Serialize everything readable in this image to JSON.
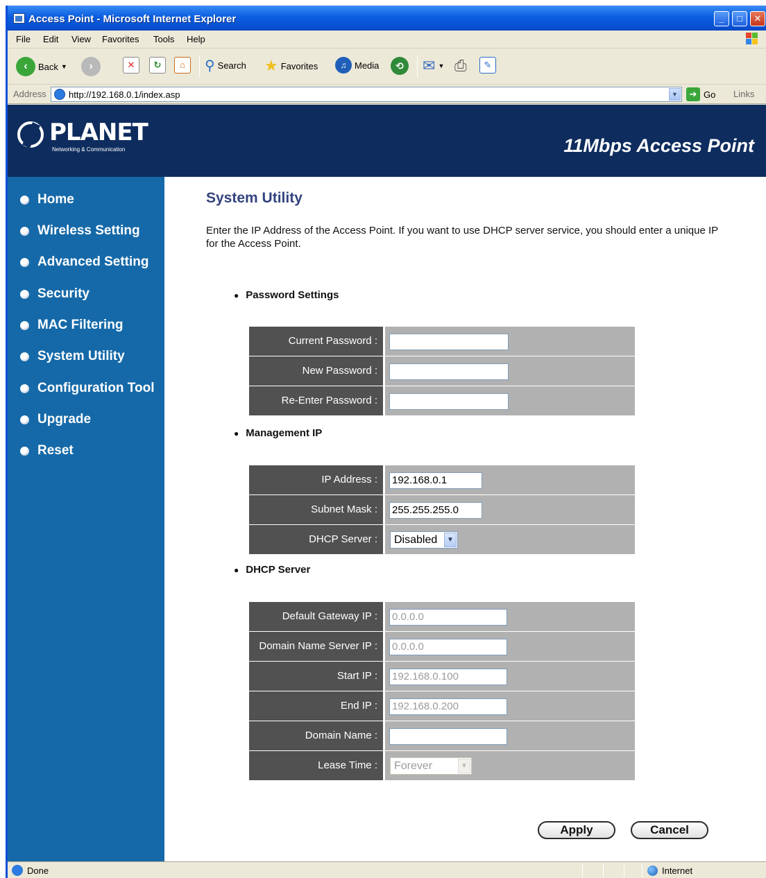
{
  "window": {
    "title": "Access Point - Microsoft Internet Explorer",
    "controls": {
      "minimize": "_",
      "maximize": "□",
      "close": "✕"
    }
  },
  "menu": [
    "File",
    "Edit",
    "View",
    "Favorites",
    "Tools",
    "Help"
  ],
  "toolbar": {
    "back_label": "Back",
    "search_label": "Search",
    "favorites_label": "Favorites",
    "media_label": "Media"
  },
  "address": {
    "label": "Address",
    "url": "http://192.168.0.1/index.asp",
    "go_label": "Go",
    "links_label": "Links"
  },
  "header": {
    "logo_text": "PLANET",
    "logo_sub": "Networking & Communication",
    "product": "11Mbps Access Point"
  },
  "sidebar": {
    "items": [
      "Home",
      "Wireless Setting",
      "Advanced Setting",
      "Security",
      "MAC Filtering",
      "System Utility",
      "Configuration Tool",
      "Upgrade",
      "Reset"
    ]
  },
  "main": {
    "title": "System Utility",
    "description": "Enter the IP Address of the Access Point. If you want to use DHCP server service, you should enter a unique IP for the Access Point.",
    "password_section": "Password Settings",
    "password_rows": [
      {
        "label": "Current Password :",
        "value": ""
      },
      {
        "label": "New Password :",
        "value": ""
      },
      {
        "label": "Re-Enter Password :",
        "value": ""
      }
    ],
    "management_section": "Management IP",
    "management_rows": [
      {
        "label": "IP Address :",
        "value": "192.168.0.1"
      },
      {
        "label": "Subnet Mask :",
        "value": "255.255.255.0"
      },
      {
        "label": "DHCP Server :",
        "value": "Disabled"
      }
    ],
    "dhcp_section": "DHCP Server",
    "dhcp_rows": [
      {
        "label": "Default Gateway IP :",
        "value": "0.0.0.0"
      },
      {
        "label": "Domain Name Server IP :",
        "value": "0.0.0.0"
      },
      {
        "label": "Start IP :",
        "value": "192.168.0.100"
      },
      {
        "label": "End IP :",
        "value": "192.168.0.200"
      },
      {
        "label": "Domain Name :",
        "value": ""
      },
      {
        "label": "Lease Time :",
        "value": "Forever"
      }
    ],
    "apply_label": "Apply",
    "cancel_label": "Cancel"
  },
  "status": {
    "text": "Done",
    "zone": "Internet"
  }
}
